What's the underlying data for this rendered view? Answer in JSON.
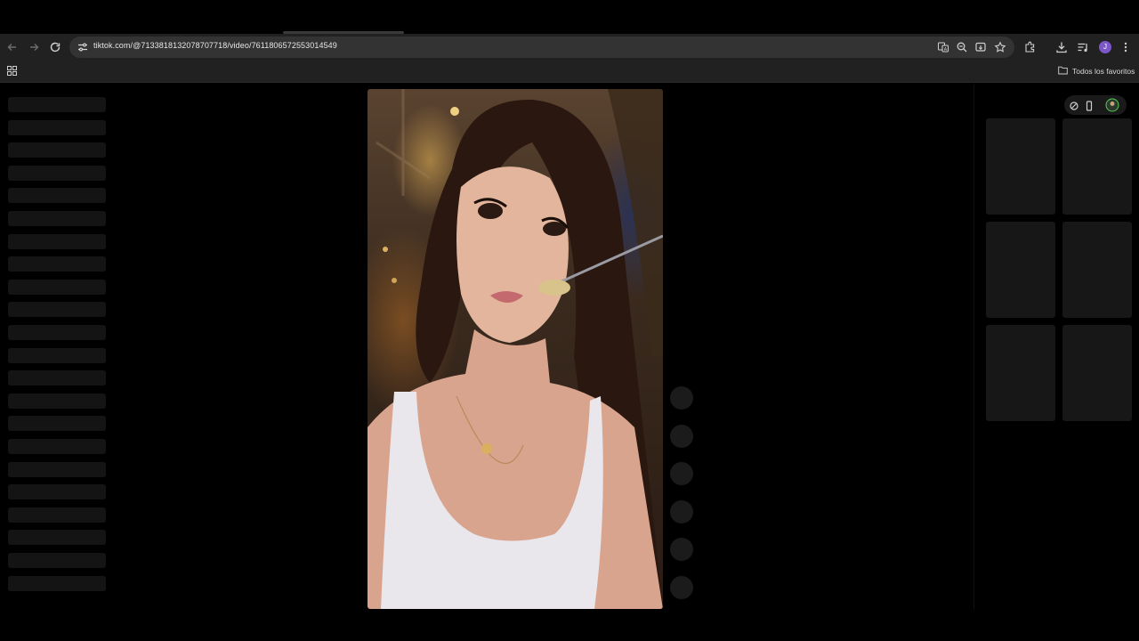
{
  "browser": {
    "url": "tiktok.com/@7133818132078707718/video/7611806572553014549",
    "avatar_letter": "J",
    "bookmarks_all_label": "Todos los favoritos",
    "nav_icons": [
      "back-arrow-icon",
      "forward-arrow-icon",
      "reload-icon"
    ],
    "toolbar_icons": [
      "translate-icon",
      "zoom-icon",
      "install-app-icon",
      "bookmark-star-icon",
      "extensions-icon",
      "download-icon",
      "media-control-icon",
      "menu-kebab-icon"
    ],
    "apps_icon": "apps-grid-icon"
  },
  "page": {
    "sidebar_skeleton_rows": 22,
    "action_button_count": 6,
    "thumbnail_rows": 3,
    "thumbnail_cols": 2,
    "video_subject": "Woman holding a fork near her mouth at night, white tank top, gold pendant necklace",
    "right_top_icons": [
      "slash-circle-icon",
      "phone-icon",
      "profile-badge-icon"
    ],
    "colors": {
      "page_bg": "#000000",
      "toolbar_bg": "#212121",
      "omnibox_bg": "#333333",
      "avatar": "#7b57c8",
      "skeleton": "#141414"
    }
  }
}
